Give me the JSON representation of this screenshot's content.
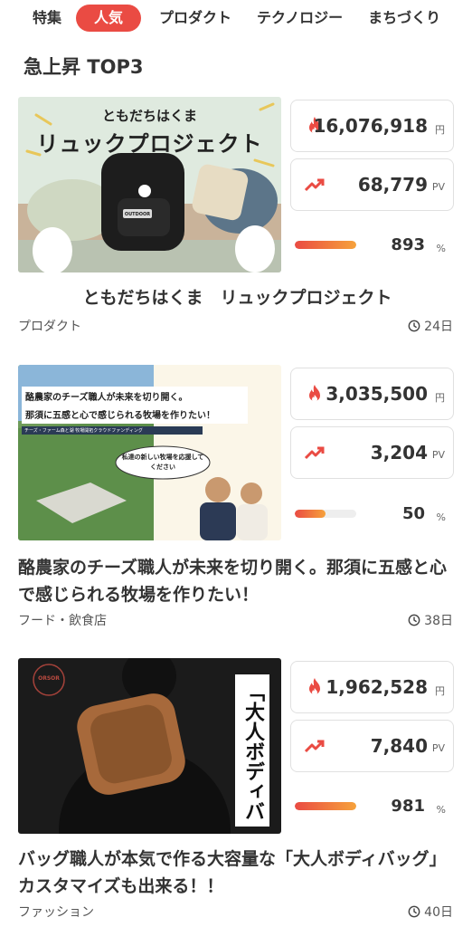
{
  "tabs": [
    "特集",
    "人気",
    "プロダクト",
    "テクノロジー",
    "まちづくり"
  ],
  "active_tab": "人気",
  "section_title": "急上昇 TOP3",
  "units": {
    "amount": "円",
    "pv": "PV",
    "percent": "%"
  },
  "colors": {
    "accent": "#ea4b43",
    "progress_start": "#ea4b43",
    "progress_end": "#f6a23b"
  },
  "icons": {
    "amount": "flame-icon",
    "pv": "trend-up-icon",
    "days": "clock-icon"
  },
  "projects": [
    {
      "thumb_heading": "ともだちはくま",
      "thumb_title": "リュックプロジェクト",
      "thumb_bag_logo": "OUTDOOR",
      "amount": "16,076,918",
      "pv": "68,779",
      "percent": "893",
      "progress": 1.0,
      "title": "ともだちはくま　リュックプロジェクト",
      "category": "プロダクト",
      "days": "24日"
    },
    {
      "thumb_line1": "酪農家のチーズ職人が未来を切り開く。",
      "thumb_line2": "那須に五感と心で感じられる牧場を作りたい！",
      "thumb_subline": "チーズ・ファーム森と湖 牧場開拓クラウドファンディング",
      "thumb_bubble": "私達の新しい牧場を応援してください",
      "amount": "3,035,500",
      "pv": "3,204",
      "percent": "50",
      "progress": 0.5,
      "title": "酪農家のチーズ職人が未来を切り開く。那須に五感と心で感じられる牧場を作りたい！",
      "category": "フード・飲食店",
      "days": "38日"
    },
    {
      "thumb_logo": "ORSOR",
      "thumb_vertical": "「大人ボディバッグ」",
      "amount": "1,962,528",
      "pv": "7,840",
      "percent": "981",
      "progress": 1.0,
      "title": "バッグ職人が本気で作る大容量な「大人ボディバッグ」　カスタマイズも出来る！！",
      "category": "ファッション",
      "days": "40日"
    }
  ]
}
